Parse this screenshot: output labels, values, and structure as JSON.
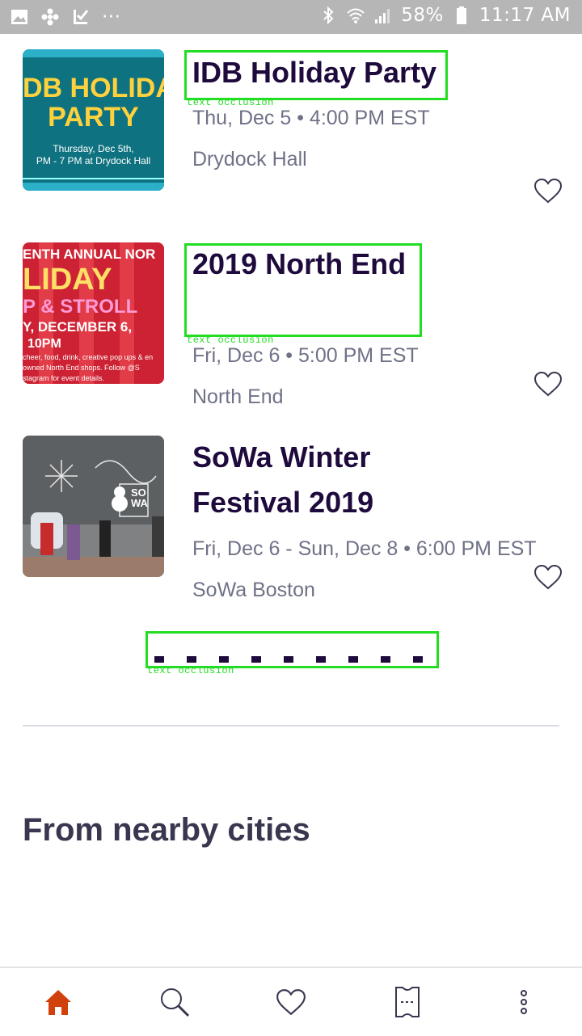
{
  "status_bar": {
    "battery": "58%",
    "time": "11:17 AM",
    "more": "···"
  },
  "events": [
    {
      "title": "IDB Holiday Party",
      "datetime": "Thu, Dec 5 • 4:00 PM EST",
      "venue": "Drydock Hall",
      "thumb": {
        "line1": "DB HOLIDA",
        "line2": "PARTY",
        "line3": "Thursday, Dec 5th,",
        "line4": "PM - 7 PM at Drydock Hall"
      }
    },
    {
      "title": "2019 North End",
      "datetime": "Fri, Dec 6 • 5:00 PM EST",
      "venue": "North End",
      "thumb": {
        "line1": "ENTH ANNUAL NOR",
        "line2": "LIDAY",
        "line3": "P & STROLL",
        "line4": "Y, DECEMBER 6,",
        "line5": "10PM",
        "line6": "cheer, food, drink, creative pop ups & en",
        "line7": "owned North End shops. Follow @S",
        "line8": "stagram for event details."
      }
    },
    {
      "title_line1": "SoWa Winter",
      "title_line2": "Festival 2019",
      "datetime": "Fri, Dec 6 - Sun, Dec 8 • 6:00 PM EST",
      "venue": "SoWa Boston",
      "thumb": {
        "sign": "SO WA"
      }
    }
  ],
  "occlusion_label": "text occlusion",
  "section_title": "From nearby cities",
  "nav": {
    "home": "home-icon",
    "search": "search-icon",
    "likes": "heart-icon",
    "tickets": "ticket-icon",
    "more": "more-icon"
  },
  "colors": {
    "accent": "#d1410c",
    "title": "#1e0a3c",
    "meta": "#6f7287",
    "outline": "#22dd22"
  }
}
